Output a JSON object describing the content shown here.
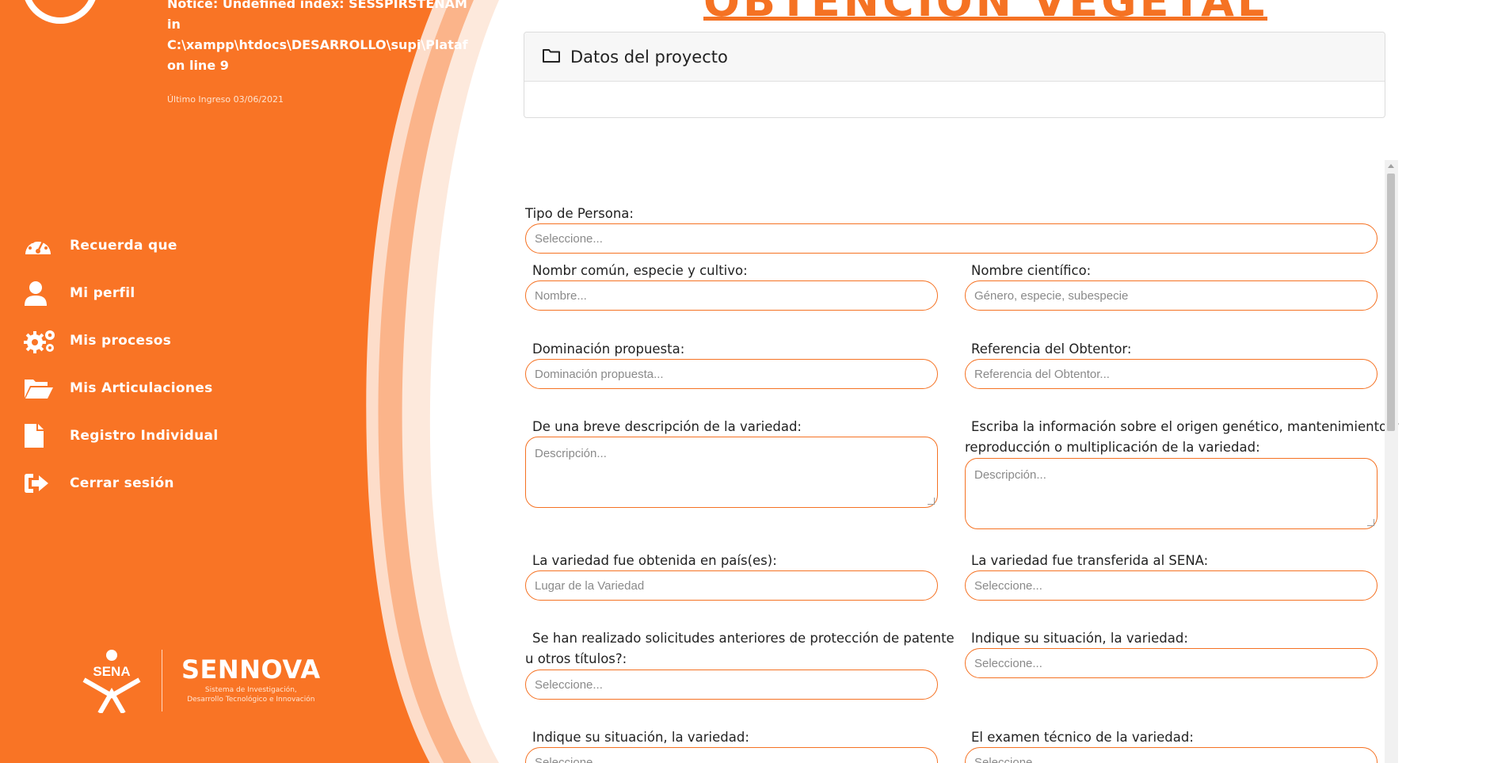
{
  "header": {
    "php_notice_lines": [
      "Notice: Undefined index: SESSPIRSTENAME",
      "in",
      "C:\\xampp\\htdocs\\DESARROLLO\\supi\\Plataf",
      "on line 9"
    ],
    "last_login": "Último Ingreso 03/06/2021",
    "page_title": "OBTENCIÓN VEGETAL"
  },
  "sidebar": {
    "items": [
      {
        "label": "Recuerda que",
        "icon": "dashboard-icon"
      },
      {
        "label": "Mi perfil",
        "icon": "user-icon"
      },
      {
        "label": "Mis procesos",
        "icon": "gears-icon"
      },
      {
        "label": "Mis Articulaciones",
        "icon": "folder-open-icon"
      },
      {
        "label": "Registro Individual",
        "icon": "file-icon"
      },
      {
        "label": "Cerrar sesión",
        "icon": "sign-out-icon"
      }
    ],
    "footer": {
      "sena": "SENA",
      "sennova": "SENNOVA",
      "sennova_sub_1": "Sistema de Investigación,",
      "sennova_sub_2": "Desarrollo Tecnológico e Innovación"
    }
  },
  "project_card": {
    "title": "Datos del proyecto"
  },
  "form": {
    "tipo_persona": {
      "label": "Tipo de Persona:",
      "placeholder": "Seleccione..."
    },
    "nombre_comun": {
      "label": "Nombr común, especie y cultivo:",
      "placeholder": "Nombre..."
    },
    "nombre_cientifico": {
      "label": "Nombre científico:",
      "placeholder": "Género, especie, subespecie"
    },
    "dominacion": {
      "label": "Dominación propuesta:",
      "placeholder": "Dominación propuesta..."
    },
    "referencia": {
      "label": "Referencia del Obtentor:",
      "placeholder": "Referencia del Obtentor..."
    },
    "descripcion": {
      "label": "De una breve descripción de la variedad:",
      "placeholder": "Descripción..."
    },
    "origen_line1": "Escriba la información sobre el origen genético, mantenimiento y",
    "origen_line2": "reproducción o multiplicación de la variedad:",
    "origen_placeholder": "Descripción...",
    "pais": {
      "label": "La variedad fue obtenida en país(es):",
      "placeholder": "Lugar de la Variedad"
    },
    "transferida": {
      "label": "La variedad fue transferida al SENA:",
      "placeholder": "Seleccione..."
    },
    "solicitudes_line1": "Se han realizado solicitudes anteriores de protección de patente",
    "solicitudes_line2": "u otros títulos?:",
    "solicitudes_placeholder": "Seleccione...",
    "situacion_1": {
      "label": "Indique su situación, la variedad:",
      "placeholder": "Seleccione..."
    },
    "situacion_2": {
      "label": "Indique su situación, la variedad:",
      "placeholder": "Seleccione..."
    },
    "examen": {
      "label": "El examen técnico de la variedad:",
      "placeholder": "Seleccione..."
    }
  },
  "colors": {
    "brand_orange": "#f57223",
    "sidebar_orange": "#f97425"
  }
}
